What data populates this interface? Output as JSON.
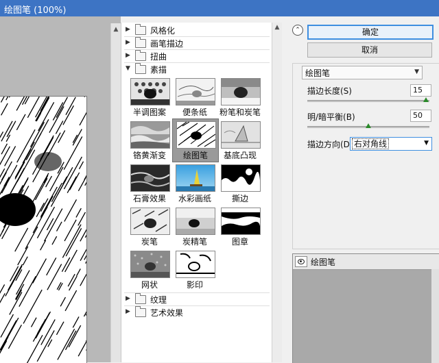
{
  "window": {
    "title": "绘图笔 (100%)"
  },
  "gallery": {
    "categories_top": [
      "风格化",
      "画笔描边",
      "扭曲"
    ],
    "open_category": "素描",
    "thumbnails": [
      {
        "label": "半调图案"
      },
      {
        "label": "便条纸"
      },
      {
        "label": "粉笔和炭笔"
      },
      {
        "label": "铬黄渐变"
      },
      {
        "label": "绘图笔",
        "selected": true
      },
      {
        "label": "基底凸现"
      },
      {
        "label": "石膏效果"
      },
      {
        "label": "水彩画纸"
      },
      {
        "label": "撕边"
      },
      {
        "label": "炭笔"
      },
      {
        "label": "炭精笔"
      },
      {
        "label": "图章"
      },
      {
        "label": "网状"
      },
      {
        "label": "影印"
      }
    ],
    "categories_bottom": [
      "纹理",
      "艺术效果"
    ]
  },
  "panel": {
    "ok_label": "确定",
    "cancel_label": "取消",
    "filter_select": "绘图笔",
    "stroke_length_label": "描边长度(S)",
    "stroke_length_value": "15",
    "stroke_length_level": 0.97,
    "balance_label": "明/暗平衡(B)",
    "balance_value": "50",
    "balance_level": 0.5,
    "direction_label": "描边方向(D):",
    "direction_value": "右对角线",
    "layer_name": "绘图笔"
  },
  "colors": {
    "title_bar": "#3d74c4",
    "slider_thumb": "#2a8a2a",
    "focus": "#3d8ee0"
  }
}
